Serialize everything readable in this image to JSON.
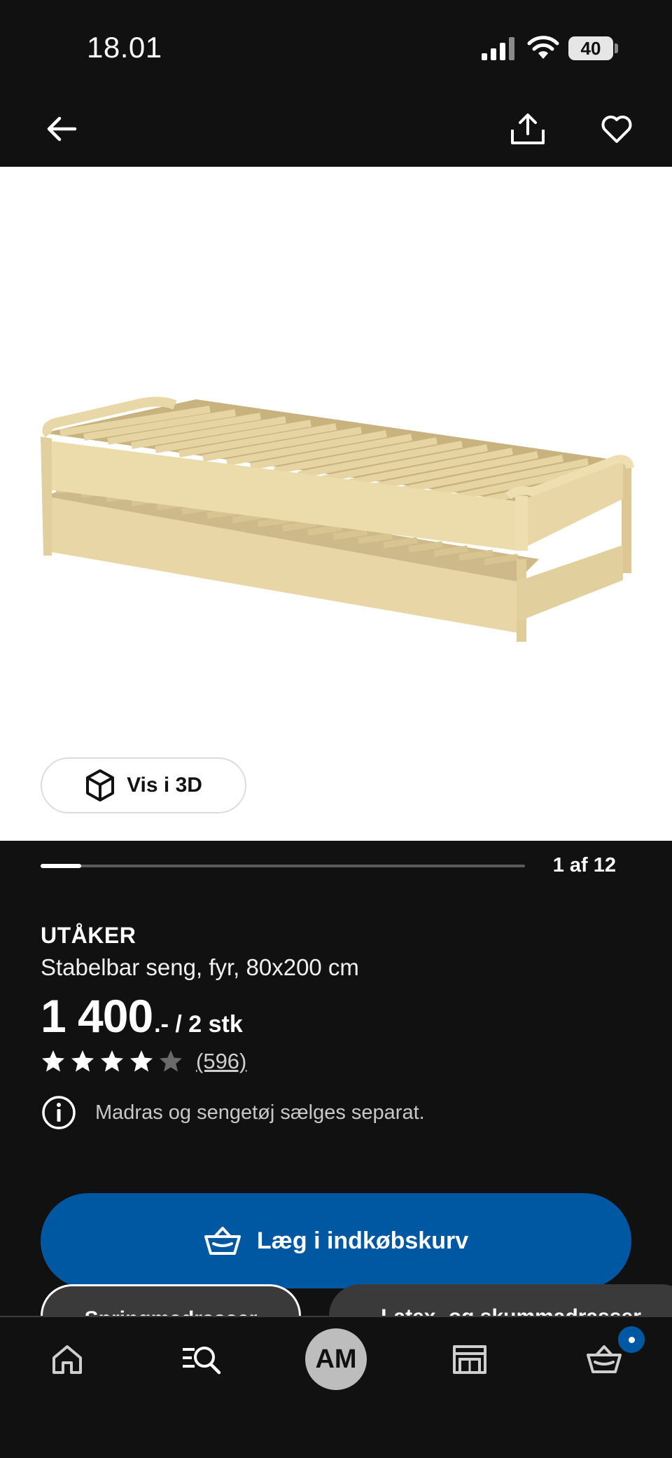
{
  "status_bar": {
    "time": "18.01",
    "battery": "40"
  },
  "nav": {
    "back_icon": "arrow-left-icon",
    "share_icon": "share-icon",
    "favorite_icon": "heart-icon"
  },
  "gallery": {
    "view_3d_label": "Vis i 3D",
    "page_indicator": "1 af 12",
    "current_page": 1,
    "total_pages": 12
  },
  "product": {
    "name": "UTÅKER",
    "description": "Stabelbar seng, fyr, 80x200 cm",
    "price": "1 400",
    "price_suffix": ".- / 2 stk",
    "rating": 4,
    "rating_max": 5,
    "review_count": "(596)",
    "notice": "Madras og sengetøj sælges separat."
  },
  "actions": {
    "add_to_cart": "Læg i indkøbskurv"
  },
  "chips": [
    "Springmadrasser",
    "Latex- og skummadrasser"
  ],
  "tabbar": {
    "avatar_initials": "AM"
  },
  "colors": {
    "accent": "#0058a3",
    "background": "#111111",
    "surface": "#ffffff"
  }
}
